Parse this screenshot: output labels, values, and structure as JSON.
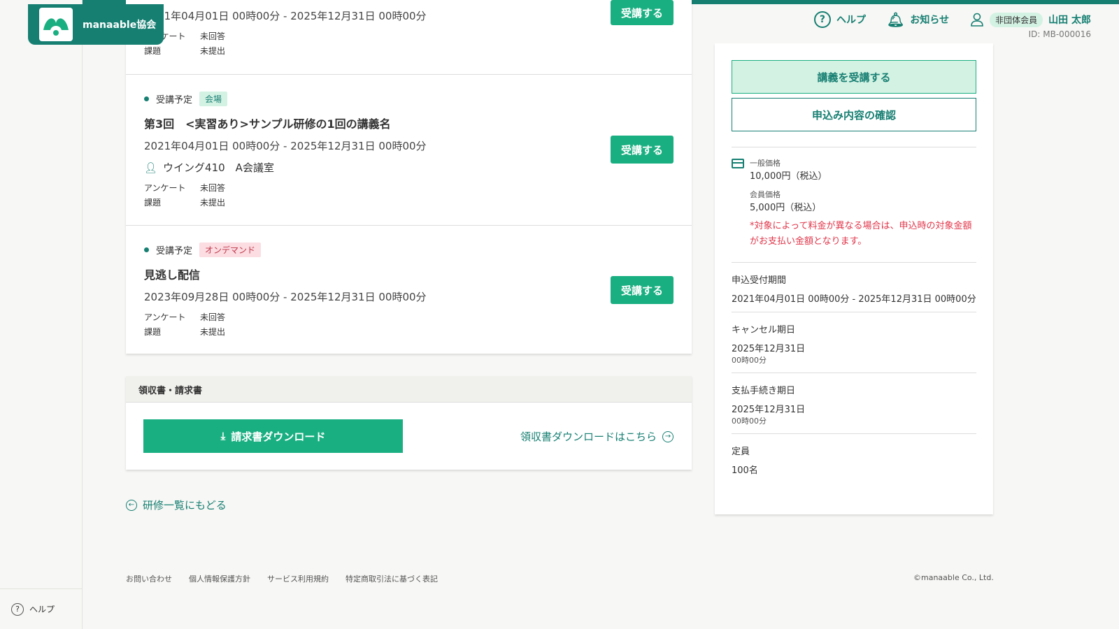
{
  "brand": "manaable協会",
  "header": {
    "help": "ヘルプ",
    "notice": "お知らせ",
    "member_badge": "非団体会員",
    "user_name": "山田 太郎",
    "user_id": "ID: MB-000016"
  },
  "sidebar": {
    "help": "ヘルプ"
  },
  "sessions": [
    {
      "date": "2021年04月01日 00時00分 - 2025年12月31日 00時00分",
      "survey_label": "アンケート",
      "survey": "未回答",
      "task_label": "課題",
      "task": "未提出",
      "button": "受講する"
    },
    {
      "status": "受講予定",
      "tag": "会場",
      "title": "第3回　<実習あり>サンプル研修の1回の講義名",
      "date": "2021年04月01日 00時00分 - 2025年12月31日 00時00分",
      "location": "ウイング410　A会議室",
      "survey_label": "アンケート",
      "survey": "未回答",
      "task_label": "課題",
      "task": "未提出",
      "button": "受講する"
    },
    {
      "status": "受講予定",
      "tag": "オンデマンド",
      "title": "見逃し配信",
      "date": "2023年09月28日 00時00分 - 2025年12月31日 00時00分",
      "survey_label": "アンケート",
      "survey": "未回答",
      "task_label": "課題",
      "task": "未提出",
      "button": "受講する"
    }
  ],
  "receipt": {
    "heading": "領収書・請求書",
    "invoice_button": "請求書ダウンロード",
    "receipt_link": "領収書ダウンロードはこちら"
  },
  "back_link": "研修一覧にもどる",
  "side_panel": {
    "attend_button": "講義を受講する",
    "confirm_button": "申込み内容の確認",
    "general_price_label": "一般価格",
    "general_price": "10,000円（税込）",
    "member_price_label": "会員価格",
    "member_price": "5,000円（税込）",
    "price_note": "*対象によって料金が異なる場合は、申込時の対象金額がお支払い金額となります。",
    "apply_period_label": "申込受付期間",
    "apply_period": "2021年04月01日 00時00分 - 2025年12月31日 00時00分",
    "cancel_label": "キャンセル期日",
    "cancel_date": "2025年12月31日",
    "cancel_time": "00時00分",
    "pay_label": "支払手続き期日",
    "pay_date": "2025年12月31日",
    "pay_time": "00時00分",
    "capacity_label": "定員",
    "capacity": "100名"
  },
  "footer": {
    "links": [
      "お問い合わせ",
      "個人情報保護方針",
      "サービス利用規約",
      "特定商取引法に基づく表記"
    ],
    "copyright": "©manaable Co., Ltd."
  },
  "colors": {
    "primary": "#167f72",
    "button": "#1aaf81",
    "alert": "#e0364a"
  }
}
